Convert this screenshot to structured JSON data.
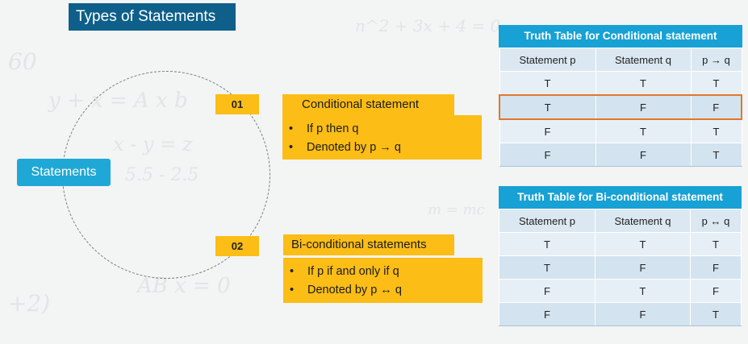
{
  "title": "Types of Statements",
  "center_label": "Statements",
  "items": [
    {
      "number": "01",
      "heading": "Conditional statement",
      "bullets": [
        "If p then q",
        "Denoted by p → q"
      ]
    },
    {
      "number": "02",
      "heading": "Bi-conditional statements",
      "bullets": [
        "If p if and only if q",
        "Denoted by p ↔ q"
      ]
    }
  ],
  "tables": [
    {
      "title": "Truth Table for Conditional statement",
      "headers": [
        "Statement p",
        "Statement q",
        "p → q"
      ],
      "rows": [
        [
          "T",
          "T",
          "T"
        ],
        [
          "T",
          "F",
          "F"
        ],
        [
          "F",
          "T",
          "T"
        ],
        [
          "F",
          "F",
          "T"
        ]
      ],
      "highlighted_row": 1
    },
    {
      "title": "Truth Table for Bi-conditional statement",
      "headers": [
        "Statement p",
        "Statement q",
        "p ↔ q"
      ],
      "rows": [
        [
          "T",
          "T",
          "T"
        ],
        [
          "T",
          "F",
          "F"
        ],
        [
          "F",
          "T",
          "F"
        ],
        [
          "F",
          "F",
          "T"
        ]
      ]
    }
  ],
  "colors": {
    "title_bg": "#0e5f8a",
    "accent_yellow": "#fbbd16",
    "table_header": "#17a1d4",
    "highlight_border": "#e0782c"
  }
}
